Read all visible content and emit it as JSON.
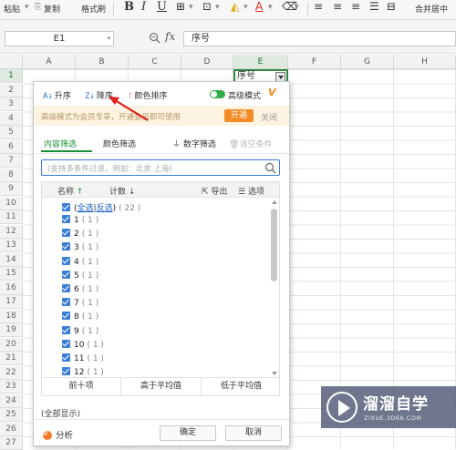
{
  "toolbar": {
    "paste": "粘贴",
    "copy": "复制",
    "format_painter": "格式刷",
    "bold": "B",
    "italic": "I",
    "underline": "U",
    "merge_center": "合并居中"
  },
  "formula_bar": {
    "name_box": "E1",
    "fx": "fx",
    "value": "序号"
  },
  "columns": [
    "A",
    "B",
    "C",
    "D",
    "E",
    "F",
    "G",
    "H"
  ],
  "rows": [
    "1",
    "2",
    "3",
    "4",
    "5",
    "6",
    "7",
    "8",
    "9",
    "10",
    "11",
    "12",
    "13",
    "14",
    "15",
    "16",
    "17",
    "18",
    "19",
    "20",
    "21",
    "22",
    "23",
    "24",
    "25",
    "26",
    "27"
  ],
  "cell_e1": "序号",
  "filter_panel": {
    "sort_asc": "升序",
    "sort_desc": "降序",
    "color_sort": "颜色排序",
    "advanced_mode": "高级模式",
    "vip_mark": "V",
    "banner_text": "高级模式为会员专享，开通会员即可使用",
    "open_button": "开通",
    "close_link": "关闭",
    "tab_content": "内容筛选",
    "tab_color": "颜色筛选",
    "number_filter": "数字筛选",
    "clear_condition": "清空条件",
    "search_placeholder": "(支持多条件过滤，例如：北京 上海)",
    "col_name": "名称",
    "col_name_arrow": "↑",
    "col_count": "计数",
    "col_count_arrow": "↓",
    "export": "导出",
    "options": "选项",
    "select_all": {
      "all": "全选",
      "sep": "|",
      "invert": "反选",
      "count": "( 22 )"
    },
    "items": [
      {
        "label": "1",
        "count": "( 1 )"
      },
      {
        "label": "2",
        "count": "( 1 )"
      },
      {
        "label": "3",
        "count": "( 1 )"
      },
      {
        "label": "4",
        "count": "( 1 )"
      },
      {
        "label": "5",
        "count": "( 1 )"
      },
      {
        "label": "6",
        "count": "( 1 )"
      },
      {
        "label": "7",
        "count": "( 1 )"
      },
      {
        "label": "8",
        "count": "( 1 )"
      },
      {
        "label": "9",
        "count": "( 1 )"
      },
      {
        "label": "10",
        "count": "( 1 )"
      },
      {
        "label": "11",
        "count": "( 1 )"
      },
      {
        "label": "12",
        "count": "( 1 )"
      }
    ],
    "top10": "前十项",
    "above_avg": "高于平均值",
    "below_avg": "低于平均值",
    "show_all": "(全部显示)",
    "analysis": "分析",
    "ok": "确定",
    "cancel": "取消"
  },
  "watermark": {
    "title": "溜溜自学",
    "subtitle": "ZIXUE.3D66.COM"
  },
  "colors": {
    "accent_green": "#1c8f3a",
    "checkbox_blue": "#3b7ed6",
    "open_orange": "#f38b25",
    "arrow_red": "#e0201b"
  }
}
